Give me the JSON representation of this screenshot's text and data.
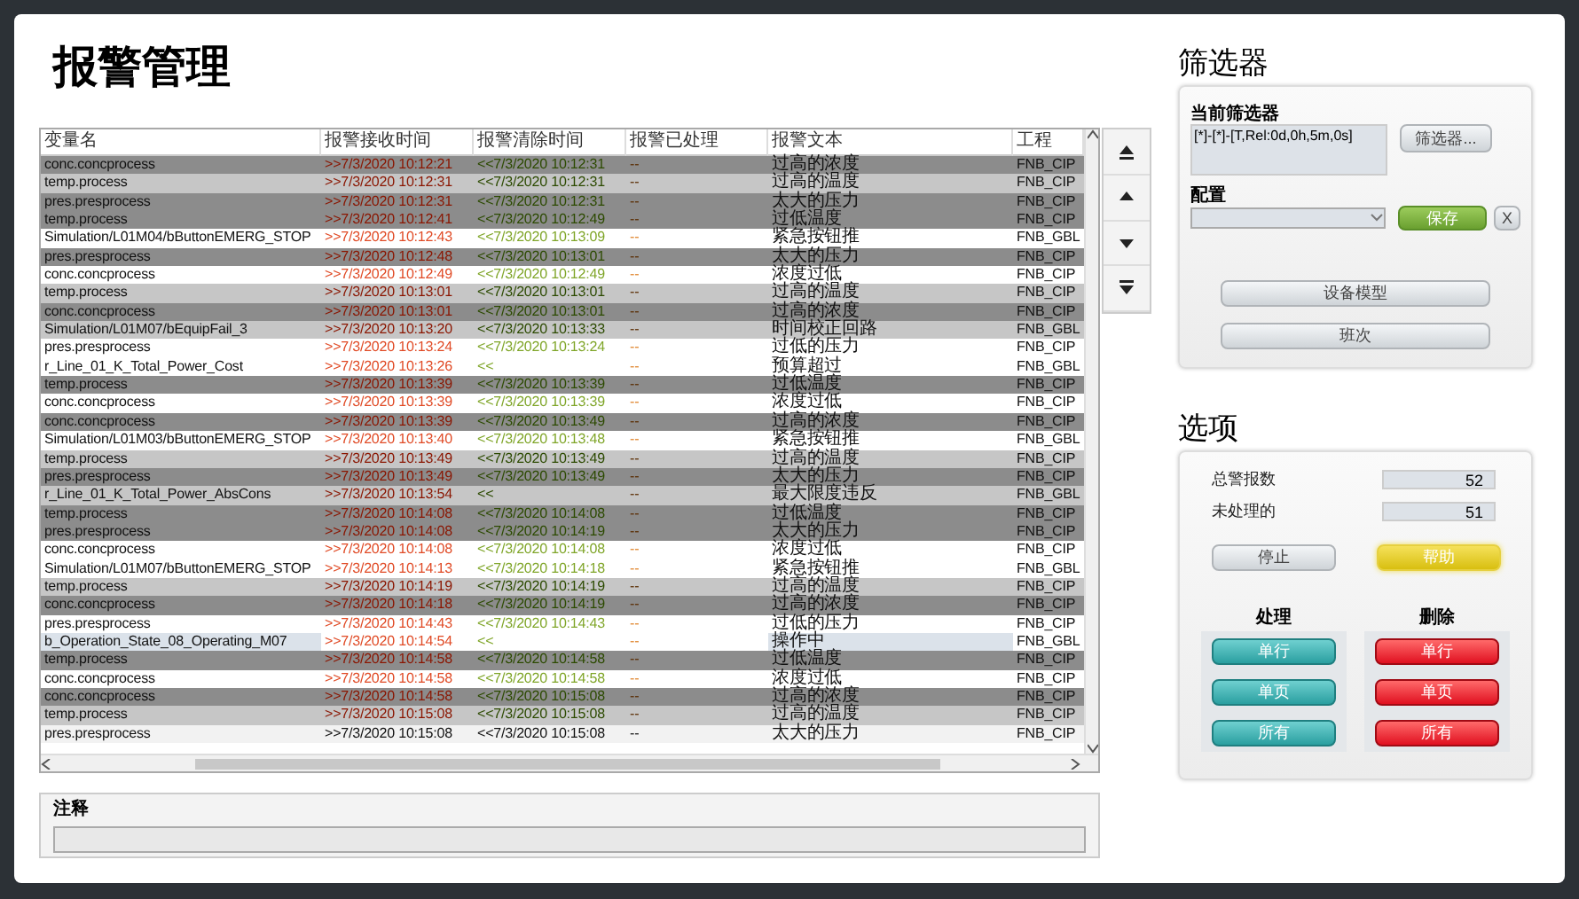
{
  "title": "报警管理",
  "table": {
    "columns": [
      "变量名",
      "报警接收时间",
      "报警清除时间",
      "报警已处理",
      "报警文本",
      "工程"
    ],
    "rows": [
      {
        "kind": "dark",
        "cells": [
          "conc.concprocess",
          ">>7/3/2020 10:12:21",
          "<<7/3/2020 10:12:31",
          "--",
          "过高的浓度",
          "FNB_CIP"
        ]
      },
      {
        "kind": "light",
        "cells": [
          "temp.process",
          ">>7/3/2020 10:12:31",
          "<<7/3/2020 10:12:31",
          "--",
          "过高的温度",
          "FNB_CIP"
        ]
      },
      {
        "kind": "dark",
        "cells": [
          "pres.presprocess",
          ">>7/3/2020 10:12:31",
          "<<7/3/2020 10:12:31",
          "--",
          "太大的压力",
          "FNB_CIP"
        ]
      },
      {
        "kind": "dark",
        "cells": [
          "temp.process",
          ">>7/3/2020 10:12:41",
          "<<7/3/2020 10:12:49",
          "--",
          "过低温度",
          "FNB_CIP"
        ]
      },
      {
        "kind": "white",
        "cells": [
          "Simulation/L01M04/bButtonEMERG_STOP",
          ">>7/3/2020 10:12:43",
          "<<7/3/2020 10:13:09",
          "--",
          "紧急按钮推",
          "FNB_GBL"
        ]
      },
      {
        "kind": "dark",
        "cells": [
          "pres.presprocess",
          ">>7/3/2020 10:12:48",
          "<<7/3/2020 10:13:01",
          "--",
          "太大的压力",
          "FNB_CIP"
        ]
      },
      {
        "kind": "white",
        "cells": [
          "conc.concprocess",
          ">>7/3/2020 10:12:49",
          "<<7/3/2020 10:12:49",
          "--",
          "浓度过低",
          "FNB_CIP"
        ]
      },
      {
        "kind": "light",
        "cells": [
          "temp.process",
          ">>7/3/2020 10:13:01",
          "<<7/3/2020 10:13:01",
          "--",
          "过高的温度",
          "FNB_CIP"
        ]
      },
      {
        "kind": "dark",
        "cells": [
          "conc.concprocess",
          ">>7/3/2020 10:13:01",
          "<<7/3/2020 10:13:01",
          "--",
          "过高的浓度",
          "FNB_CIP"
        ]
      },
      {
        "kind": "light",
        "cells": [
          "Simulation/L01M07/bEquipFail_3",
          ">>7/3/2020 10:13:20",
          "<<7/3/2020 10:13:33",
          "--",
          "时间校正回路",
          "FNB_GBL"
        ]
      },
      {
        "kind": "white",
        "cells": [
          "pres.presprocess",
          ">>7/3/2020 10:13:24",
          "<<7/3/2020 10:13:24",
          "--",
          "过低的压力",
          "FNB_CIP"
        ]
      },
      {
        "kind": "white",
        "cells": [
          "r_Line_01_K_Total_Power_Cost",
          ">>7/3/2020 10:13:26",
          "<<",
          "--",
          "预算超过",
          "FNB_GBL"
        ]
      },
      {
        "kind": "dark",
        "cells": [
          "temp.process",
          ">>7/3/2020 10:13:39",
          "<<7/3/2020 10:13:39",
          "--",
          "过低温度",
          "FNB_CIP"
        ]
      },
      {
        "kind": "white",
        "cells": [
          "conc.concprocess",
          ">>7/3/2020 10:13:39",
          "<<7/3/2020 10:13:39",
          "--",
          "浓度过低",
          "FNB_CIP"
        ]
      },
      {
        "kind": "dark",
        "cells": [
          "conc.concprocess",
          ">>7/3/2020 10:13:39",
          "<<7/3/2020 10:13:49",
          "--",
          "过高的浓度",
          "FNB_CIP"
        ]
      },
      {
        "kind": "white",
        "cells": [
          "Simulation/L01M03/bButtonEMERG_STOP",
          ">>7/3/2020 10:13:40",
          "<<7/3/2020 10:13:48",
          "--",
          "紧急按钮推",
          "FNB_GBL"
        ]
      },
      {
        "kind": "light",
        "cells": [
          "temp.process",
          ">>7/3/2020 10:13:49",
          "<<7/3/2020 10:13:49",
          "--",
          "过高的温度",
          "FNB_CIP"
        ]
      },
      {
        "kind": "dark",
        "cells": [
          "pres.presprocess",
          ">>7/3/2020 10:13:49",
          "<<7/3/2020 10:13:49",
          "--",
          "太大的压力",
          "FNB_CIP"
        ]
      },
      {
        "kind": "light",
        "cells": [
          "r_Line_01_K_Total_Power_AbsCons",
          ">>7/3/2020 10:13:54",
          "<<",
          "--",
          "最大限度违反",
          "FNB_GBL"
        ]
      },
      {
        "kind": "dark",
        "cells": [
          "temp.process",
          ">>7/3/2020 10:14:08",
          "<<7/3/2020 10:14:08",
          "--",
          "过低温度",
          "FNB_CIP"
        ]
      },
      {
        "kind": "dark",
        "cells": [
          "pres.presprocess",
          ">>7/3/2020 10:14:08",
          "<<7/3/2020 10:14:19",
          "--",
          "太大的压力",
          "FNB_CIP"
        ]
      },
      {
        "kind": "white",
        "cells": [
          "conc.concprocess",
          ">>7/3/2020 10:14:08",
          "<<7/3/2020 10:14:08",
          "--",
          "浓度过低",
          "FNB_CIP"
        ]
      },
      {
        "kind": "white",
        "cells": [
          "Simulation/L01M07/bButtonEMERG_STOP",
          ">>7/3/2020 10:14:13",
          "<<7/3/2020 10:14:18",
          "--",
          "紧急按钮推",
          "FNB_GBL"
        ]
      },
      {
        "kind": "light",
        "cells": [
          "temp.process",
          ">>7/3/2020 10:14:19",
          "<<7/3/2020 10:14:19",
          "--",
          "过高的温度",
          "FNB_CIP"
        ]
      },
      {
        "kind": "dark",
        "cells": [
          "conc.concprocess",
          ">>7/3/2020 10:14:18",
          "<<7/3/2020 10:14:19",
          "--",
          "过高的浓度",
          "FNB_CIP"
        ]
      },
      {
        "kind": "white",
        "cells": [
          "pres.presprocess",
          ">>7/3/2020 10:14:43",
          "<<7/3/2020 10:14:43",
          "--",
          "过低的压力",
          "FNB_CIP"
        ]
      },
      {
        "kind": "focus",
        "cells": [
          "b_Operation_State_08_Operating_M07",
          ">>7/3/2020 10:14:54",
          "<<",
          "--",
          "操作中",
          "FNB_GBL"
        ]
      },
      {
        "kind": "dark",
        "cells": [
          "temp.process",
          ">>7/3/2020 10:14:58",
          "<<7/3/2020 10:14:58",
          "--",
          "过低温度",
          "FNB_CIP"
        ]
      },
      {
        "kind": "white",
        "cells": [
          "conc.concprocess",
          ">>7/3/2020 10:14:58",
          "<<7/3/2020 10:14:58",
          "--",
          "浓度过低",
          "FNB_CIP"
        ]
      },
      {
        "kind": "dark",
        "cells": [
          "conc.concprocess",
          ">>7/3/2020 10:14:58",
          "<<7/3/2020 10:15:08",
          "--",
          "过高的浓度",
          "FNB_CIP"
        ]
      },
      {
        "kind": "light",
        "cells": [
          "temp.process",
          ">>7/3/2020 10:15:08",
          "<<7/3/2020 10:15:08",
          "--",
          "过高的温度",
          "FNB_CIP"
        ]
      },
      {
        "kind": "plain",
        "cells": [
          "pres.presprocess",
          ">>7/3/2020 10:15:08",
          "<<7/3/2020 10:15:08",
          "--",
          "太大的压力",
          "FNB_CIP"
        ]
      }
    ]
  },
  "comment": {
    "label": "注释"
  },
  "filter": {
    "title": "筛选器",
    "current_label": "当前筛选器",
    "current_value": "[*]-[*]-[T,Rel:0d,0h,5m,0s]",
    "filter_button": "筛选器...",
    "config_label": "配置",
    "save_button": "保存",
    "clear_button": "X",
    "buttons": [
      "设备模型",
      "班次"
    ]
  },
  "options": {
    "title": "选项",
    "counters": [
      {
        "label": "总警报数",
        "value": "52"
      },
      {
        "label": "未处理的",
        "value": "51"
      }
    ],
    "stop_button": "停止",
    "help_button": "帮助",
    "groups": [
      {
        "title": "处理",
        "kind": "acknowledge",
        "buttons": [
          "单行",
          "单页",
          "所有"
        ]
      },
      {
        "title": "删除",
        "kind": "delete",
        "buttons": [
          "单行",
          "单页",
          "所有"
        ]
      }
    ]
  }
}
